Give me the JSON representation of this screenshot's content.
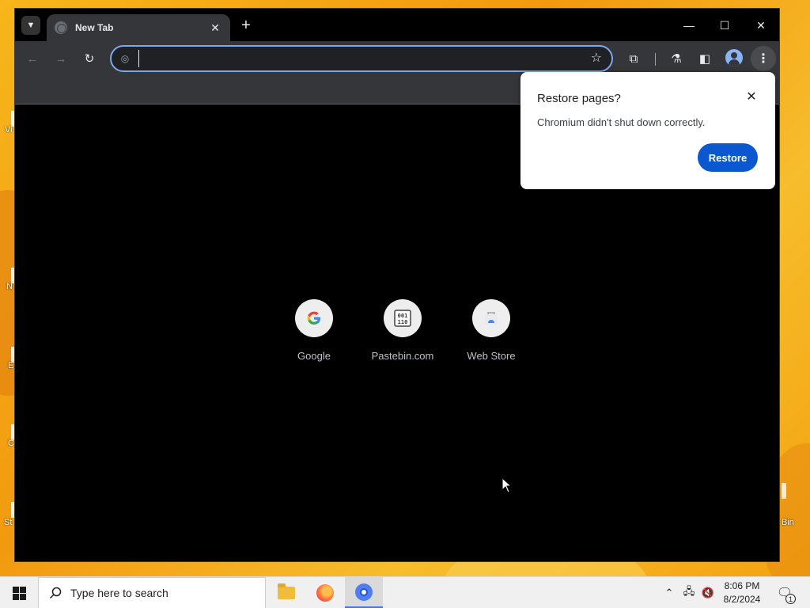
{
  "desktop": {
    "labels": [
      "Vi",
      "N",
      "E",
      "C",
      "St",
      "Bin"
    ]
  },
  "browser": {
    "tab": {
      "title": "New Tab",
      "close_glyph": "✕"
    },
    "new_tab_glyph": "+",
    "window_controls": {
      "minimize": "—",
      "maximize": "☐",
      "close": "✕"
    },
    "omnibox": {
      "value": "",
      "placeholder": ""
    },
    "shortcuts": [
      {
        "label": "Google",
        "icon": "google-icon"
      },
      {
        "label": "Pastebin.com",
        "icon": "pastebin-icon"
      },
      {
        "label": "Web Store",
        "icon": "web-store-icon"
      }
    ],
    "restore_popup": {
      "title": "Restore pages?",
      "message": "Chromium didn't shut down correctly.",
      "button": "Restore",
      "close_glyph": "✕"
    },
    "accent_color": "#0b57d0"
  },
  "taskbar": {
    "search_placeholder": "Type here to search",
    "apps": [
      "file-explorer-icon",
      "firefox-icon",
      "chromium-icon"
    ],
    "active_app": "chromium-icon",
    "clock": {
      "time": "8:06 PM",
      "date": "8/2/2024"
    },
    "notification_count": "1"
  }
}
